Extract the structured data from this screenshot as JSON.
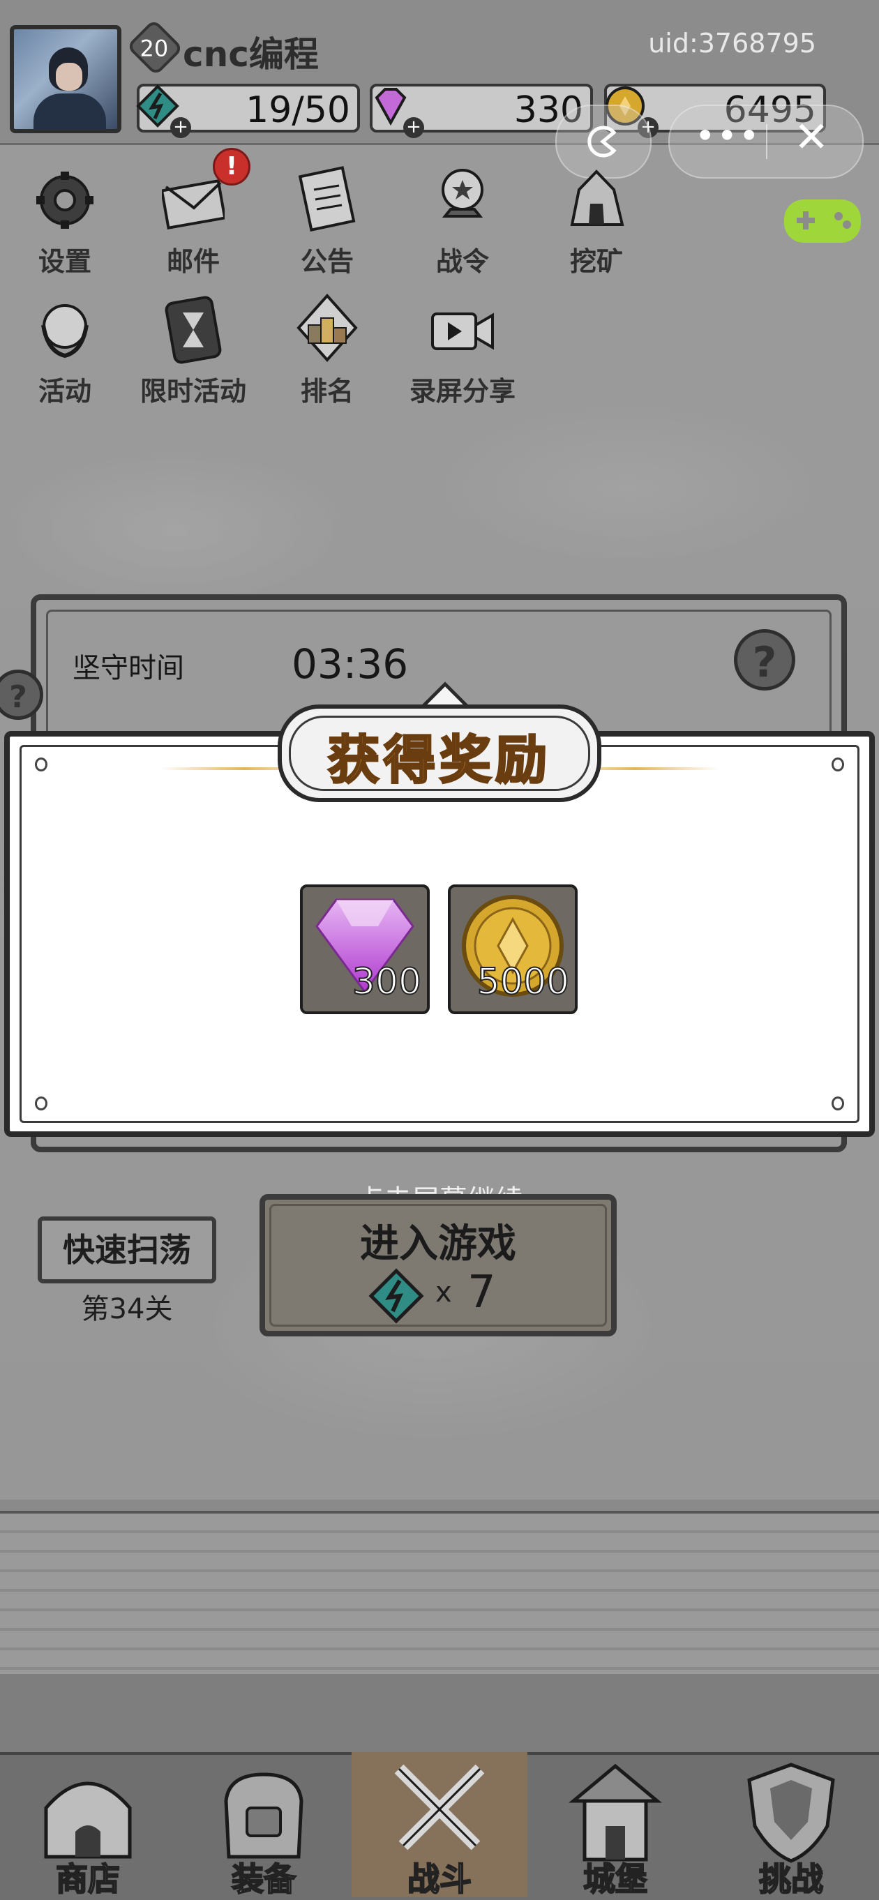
{
  "player": {
    "level": "20",
    "name": "cnc编程",
    "uid": "uid:3768795"
  },
  "resources": {
    "energy": "19/50",
    "gems": "330",
    "coins": "6495"
  },
  "menu_row1": [
    "设置",
    "邮件",
    "公告",
    "战令",
    "挖矿"
  ],
  "menu_row2": [
    "活动",
    "限时活动",
    "排名",
    "录屏分享"
  ],
  "mail_badge": "!",
  "defense": {
    "label": "坚守时间",
    "time": "03:36",
    "help": "?"
  },
  "reward_dialog": {
    "title": "获得奖励",
    "items": [
      {
        "icon": "gem-icon",
        "amount": "300"
      },
      {
        "icon": "coin-icon",
        "amount": "5000"
      }
    ]
  },
  "tap_hint": "点击屏幕继续",
  "sweep": {
    "label": "快速扫荡",
    "stage": "第34关"
  },
  "enter": {
    "label": "进入游戏",
    "cost_x": "x",
    "cost": "7"
  },
  "nav": [
    "商店",
    "装备",
    "战斗",
    "城堡",
    "挑战"
  ],
  "colors": {
    "gold_title": "#e8a93a",
    "gem": "#c46ad8",
    "coin": "#d5a72c",
    "energy": "#2f8d85",
    "gamepad": "#9fd63a",
    "badge": "#c9302c"
  }
}
